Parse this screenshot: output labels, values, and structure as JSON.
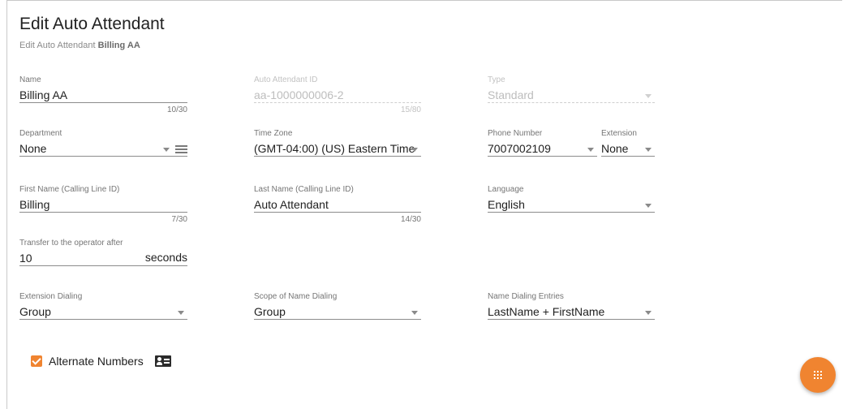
{
  "header": {
    "title": "Edit Auto Attendant",
    "subtitle_prefix": "Edit Auto Attendant",
    "subtitle_name": "Billing AA"
  },
  "fields": {
    "name": {
      "label": "Name",
      "value": "Billing AA",
      "counter": "10/30"
    },
    "aa_id": {
      "label": "Auto Attendant ID",
      "value": "aa-1000000006-2",
      "counter": "15/80"
    },
    "type": {
      "label": "Type",
      "value": "Standard"
    },
    "department": {
      "label": "Department",
      "value": "None"
    },
    "time_zone": {
      "label": "Time Zone",
      "value": "(GMT-04:00) (US) Eastern Time"
    },
    "phone_number": {
      "label": "Phone Number",
      "value": "7007002109"
    },
    "extension": {
      "label": "Extension",
      "value": "None"
    },
    "first_name": {
      "label": "First Name (Calling Line ID)",
      "value": "Billing",
      "counter": "7/30"
    },
    "last_name": {
      "label": "Last Name (Calling Line ID)",
      "value": "Auto Attendant",
      "counter": "14/30"
    },
    "language": {
      "label": "Language",
      "value": "English"
    },
    "transfer": {
      "label": "Transfer to the operator after",
      "value": "10",
      "suffix": "seconds"
    },
    "extension_dialing": {
      "label": "Extension Dialing",
      "value": "Group"
    },
    "scope_name_dialing": {
      "label": "Scope of Name Dialing",
      "value": "Group"
    },
    "name_dialing_entries": {
      "label": "Name Dialing Entries",
      "value": "LastName + FirstName"
    }
  },
  "alternate_numbers": {
    "label": "Alternate Numbers",
    "checked": true
  },
  "icons": {
    "dropdown": "chevron-down-icon",
    "list": "list-icon",
    "contact": "contact-card-icon",
    "fab": "dialpad-icon"
  },
  "colors": {
    "accent": "#f08430"
  }
}
